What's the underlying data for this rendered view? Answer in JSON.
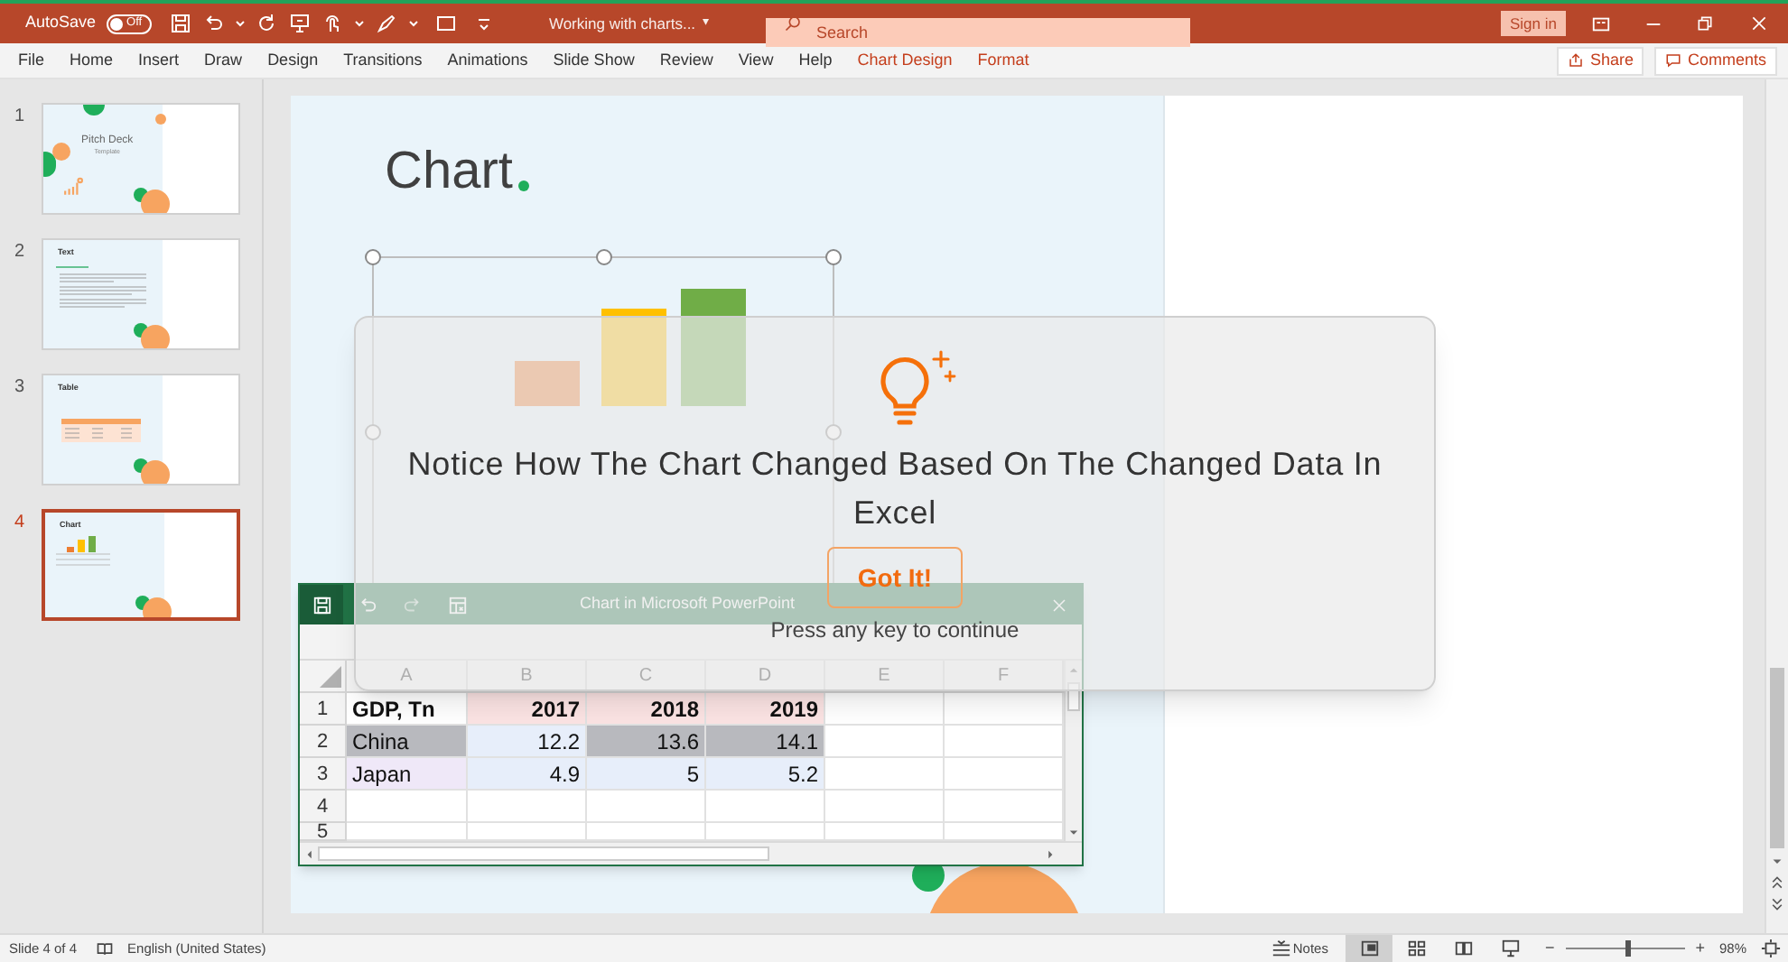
{
  "title_bar": {
    "autosave_label": "AutoSave",
    "autosave": {
      "label": "Off",
      "on": false
    },
    "document_title": "Working with charts...",
    "title_caret": "▾",
    "search": {
      "placeholder": "Search"
    },
    "sign_in": "Sign in"
  },
  "ribbon_tabs": [
    {
      "label": "File",
      "kind": "normal"
    },
    {
      "label": "Home",
      "kind": "normal"
    },
    {
      "label": "Insert",
      "kind": "normal"
    },
    {
      "label": "Draw",
      "kind": "normal"
    },
    {
      "label": "Design",
      "kind": "normal"
    },
    {
      "label": "Transitions",
      "kind": "normal"
    },
    {
      "label": "Animations",
      "kind": "normal"
    },
    {
      "label": "Slide Show",
      "kind": "normal"
    },
    {
      "label": "Review",
      "kind": "normal"
    },
    {
      "label": "View",
      "kind": "normal"
    },
    {
      "label": "Help",
      "kind": "normal"
    },
    {
      "label": "Chart Design",
      "kind": "contextual"
    },
    {
      "label": "Format",
      "kind": "contextual"
    }
  ],
  "ribbon_buttons": [
    {
      "label": "Share",
      "kind": "share"
    },
    {
      "label": "Comments",
      "kind": "comments"
    }
  ],
  "slides": [
    {
      "number": "1",
      "title": "Pitch Deck",
      "subtitle": "Template",
      "kind": "title",
      "selected": false
    },
    {
      "number": "2",
      "title": "Text",
      "kind": "text",
      "selected": false
    },
    {
      "number": "3",
      "title": "Table",
      "kind": "table",
      "selected": false
    },
    {
      "number": "4",
      "title": "Chart",
      "kind": "chart",
      "selected": true
    }
  ],
  "slide": {
    "title": "Chart"
  },
  "excel": {
    "title": "Chart in Microsoft PowerPoint",
    "columns": [
      "A",
      "B",
      "C",
      "D",
      "E",
      "F"
    ],
    "rows": [
      {
        "number": "1",
        "cells": [
          {
            "text": "GDP, Tn",
            "kind": "label",
            "selected": false
          },
          {
            "text": "2017",
            "kind": "series",
            "selected": false
          },
          {
            "text": "2018",
            "kind": "series",
            "selected": false
          },
          {
            "text": "2019",
            "kind": "series",
            "selected": false
          }
        ]
      },
      {
        "number": "2",
        "cells": [
          {
            "text": "China",
            "kind": "category",
            "selected": true
          },
          {
            "text": "12.2",
            "kind": "value",
            "selected": false
          },
          {
            "text": "13.6",
            "kind": "value",
            "selected": true
          },
          {
            "text": "14.1",
            "kind": "value",
            "selected": true
          }
        ]
      },
      {
        "number": "3",
        "cells": [
          {
            "text": "Japan",
            "kind": "category",
            "selected": false
          },
          {
            "text": "4.9",
            "kind": "value",
            "selected": false
          },
          {
            "text": "5",
            "kind": "value",
            "selected": false
          },
          {
            "text": "5.2",
            "kind": "value",
            "selected": false
          }
        ]
      },
      {
        "number": "4"
      },
      {
        "number": "5"
      }
    ]
  },
  "tip": {
    "message": "Notice How The Chart Changed Based On The Changed Data In Excel",
    "button": "Got It!",
    "hint": "Press any key to continue"
  },
  "status_bar": {
    "slide_info": "Slide 4 of 4",
    "language": "English (United States)",
    "notes": "Notes",
    "views": [
      {
        "kind": "normal",
        "selected": true
      },
      {
        "kind": "sorter",
        "selected": false
      },
      {
        "kind": "reading",
        "selected": false
      },
      {
        "kind": "slideshow",
        "selected": false
      }
    ],
    "zoom_minus": "−",
    "zoom_plus": "+",
    "zoom": {
      "level": 0.5
    },
    "zoom_percent": "98%"
  }
}
